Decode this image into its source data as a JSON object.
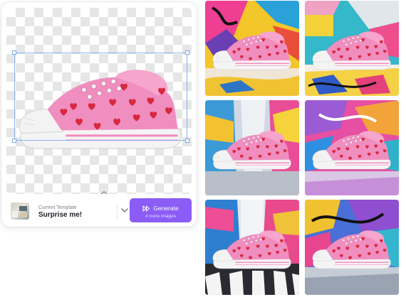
{
  "editor": {
    "template": {
      "caption": "Current Template",
      "name": "Surprise me!"
    },
    "generate": {
      "label": "Generate",
      "sublabel": "4 more images"
    }
  },
  "results": [
    {
      "style": "graffiti-yellow-pink"
    },
    {
      "style": "graffiti-teal-sign"
    },
    {
      "style": "graffiti-alley-blue"
    },
    {
      "style": "graffiti-pink-wall"
    },
    {
      "style": "street-stripes"
    },
    {
      "style": "graffiti-blue-purple"
    }
  ],
  "colors": {
    "accent": "#8b5cf6",
    "shoe_pink": "#f08ec0",
    "heart_red": "#d8283f"
  }
}
